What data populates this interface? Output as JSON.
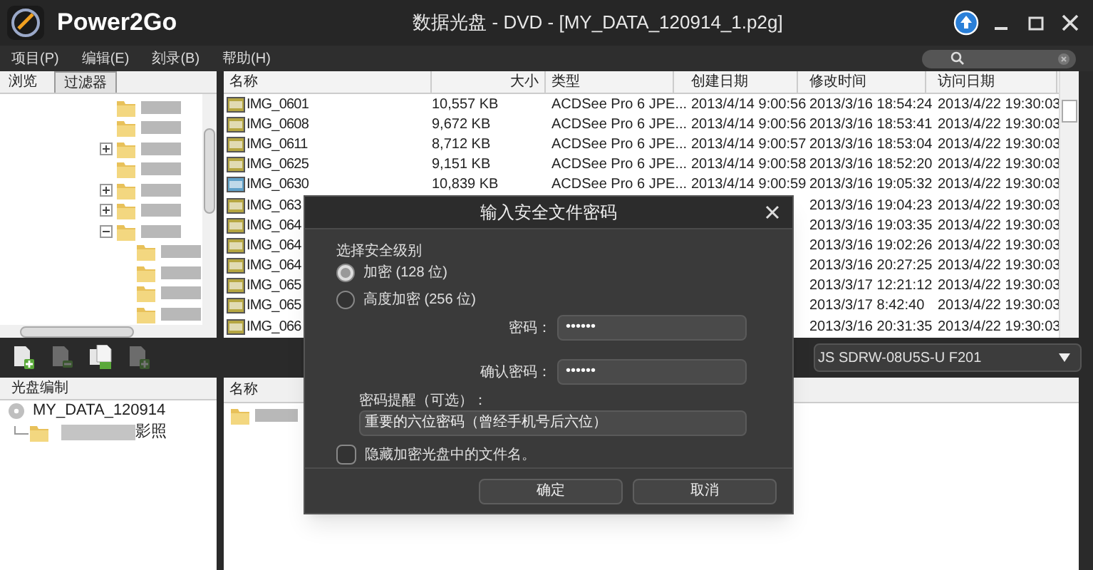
{
  "window": {
    "app_name": "Power2Go",
    "title": "数据光盘 - DVD - [MY_DATA_120914_1.p2g]"
  },
  "menu": [
    "项目(P)",
    "编辑(E)",
    "刻录(B)",
    "帮助(H)"
  ],
  "left_tabs": [
    {
      "label": "浏览",
      "selected": true
    },
    {
      "label": "过滤器",
      "selected": false
    }
  ],
  "folder_tree": [
    {
      "kind": "leaf"
    },
    {
      "kind": "leaf"
    },
    {
      "kind": "branch",
      "expanded": false
    },
    {
      "kind": "leaf"
    },
    {
      "kind": "branch",
      "expanded": false
    },
    {
      "kind": "branch",
      "expanded": false
    },
    {
      "kind": "branch",
      "expanded": true,
      "children": [
        {
          "kind": "leaf"
        },
        {
          "kind": "leaf"
        },
        {
          "kind": "leaf"
        },
        {
          "kind": "leaf"
        }
      ]
    }
  ],
  "file_list": {
    "columns": [
      "名称",
      "大小",
      "类型",
      "创建日期",
      "修改时间",
      "访问日期"
    ],
    "rows": [
      {
        "name": "IMG_0601",
        "size": "10,557 KB",
        "type": "ACDSee Pro 6 JPE...",
        "created": "2013/4/14 9:00:56",
        "modified": "2013/3/16 18:54:24",
        "accessed": "2013/4/22 19:30:03",
        "selected": false
      },
      {
        "name": "IMG_0608",
        "size": "9,672 KB",
        "type": "ACDSee Pro 6 JPE...",
        "created": "2013/4/14 9:00:56",
        "modified": "2013/3/16 18:53:41",
        "accessed": "2013/4/22 19:30:03",
        "selected": false
      },
      {
        "name": "IMG_0611",
        "size": "8,712 KB",
        "type": "ACDSee Pro 6 JPE...",
        "created": "2013/4/14 9:00:57",
        "modified": "2013/3/16 18:53:04",
        "accessed": "2013/4/22 19:30:03",
        "selected": false
      },
      {
        "name": "IMG_0625",
        "size": "9,151 KB",
        "type": "ACDSee Pro 6 JPE...",
        "created": "2013/4/14 9:00:58",
        "modified": "2013/3/16 18:52:20",
        "accessed": "2013/4/22 19:30:03",
        "selected": false
      },
      {
        "name": "IMG_0630",
        "size": "10,839 KB",
        "type": "ACDSee Pro 6 JPE...",
        "created": "2013/4/14 9:00:59",
        "modified": "2013/3/16 19:05:32",
        "accessed": "2013/4/22 19:30:03",
        "selected": true
      },
      {
        "name": "IMG_063",
        "modified": "2013/3/16 19:04:23",
        "accessed": "2013/4/22 19:30:03",
        "selected": false
      },
      {
        "name": "IMG_064",
        "modified": "2013/3/16 19:03:35",
        "accessed": "2013/4/22 19:30:03",
        "selected": false
      },
      {
        "name": "IMG_064",
        "modified": "2013/3/16 19:02:26",
        "accessed": "2013/4/22 19:30:03",
        "selected": false
      },
      {
        "name": "IMG_064",
        "modified": "2013/3/16 20:27:25",
        "accessed": "2013/4/22 19:30:03",
        "selected": false
      },
      {
        "name": "IMG_065",
        "modified": "2013/3/17 12:21:12",
        "accessed": "2013/4/22 19:30:03",
        "selected": false
      },
      {
        "name": "IMG_065",
        "modified": "2013/3/17 8:42:40",
        "accessed": "2013/4/22 19:30:03",
        "selected": false
      },
      {
        "name": "IMG_066",
        "modified": "2013/3/16 20:31:35",
        "accessed": "2013/4/22 19:30:03",
        "selected": false
      }
    ]
  },
  "toolbar": [
    {
      "kind": "add",
      "disabled": false
    },
    {
      "kind": "remove",
      "disabled": true
    },
    {
      "kind": "copy",
      "disabled": false
    },
    {
      "kind": "add",
      "disabled": true
    }
  ],
  "drive": "JS SDRW-08U5S-U F201",
  "disc_panel": {
    "header": "光盘编制",
    "root": "MY_DATA_120914",
    "child": "影照"
  },
  "disc_list": {
    "columns": [
      "名称"
    ]
  },
  "dialog": {
    "title": "输入安全文件密码",
    "group_label": "选择安全级别",
    "options": [
      {
        "label": "加密 (128 位)",
        "selected": true
      },
      {
        "label": "高度加密 (256 位)",
        "selected": false
      }
    ],
    "password_label": "密码：",
    "password": "••••••",
    "confirm_label": "确认密码：",
    "confirm": "••••••",
    "hint_label": "密码提醒（可选）：",
    "hint": "重要的六位密码（曾经手机号后六位）",
    "hide_names": {
      "label": "隐藏加密光盘中的文件名。",
      "checked": false
    },
    "buttons": [
      "确定",
      "取消"
    ]
  }
}
